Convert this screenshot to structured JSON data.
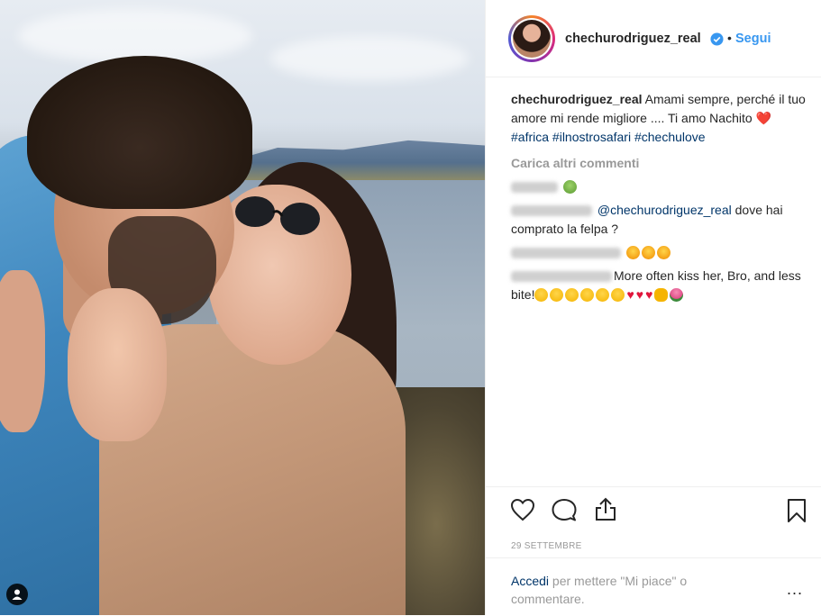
{
  "post": {
    "username": "chechurodriguez_real",
    "dot": "•",
    "follow_label": "Segui",
    "caption_user": "chechurodriguez_real",
    "caption_text": " Amami sempre, perché il tuo amore mi rende migliore .... Ti amo Nachito ",
    "caption_emoji": "❤️",
    "hashtags": [
      "#africa",
      "#ilnostrosafari",
      "#chechulove"
    ],
    "load_more": "Carica altri commenti",
    "comments": [
      {
        "mention": "",
        "text": "",
        "emojis": [
          "sick"
        ]
      },
      {
        "mention": "@chechurodriguez_real",
        "text": " dove hai comprato la felpa ?",
        "emojis": []
      },
      {
        "mention": "",
        "text": "",
        "emojis": [
          "heart-eyes",
          "heart-eyes",
          "heart-eyes"
        ]
      },
      {
        "mention": "",
        "text": "More often kiss her, Bro, and less bite!",
        "emojis": [
          "laugh",
          "laugh",
          "laugh",
          "laugh",
          "laugh",
          "laugh",
          "heart",
          "heart",
          "heart",
          "ok-hand",
          "tulip"
        ]
      }
    ],
    "date": "29 settembre",
    "login_link": "Accedi",
    "login_text": " per mettere \"Mi piace\" o commentare.",
    "more_label": "..."
  },
  "icons": [
    "heart-icon",
    "comment-icon",
    "share-icon",
    "bookmark-icon",
    "user-tag-icon",
    "verified-icon",
    "more-options-icon"
  ],
  "colors": {
    "link": "#3897f0",
    "tag": "#003569",
    "muted": "#999999",
    "text": "#262626"
  }
}
